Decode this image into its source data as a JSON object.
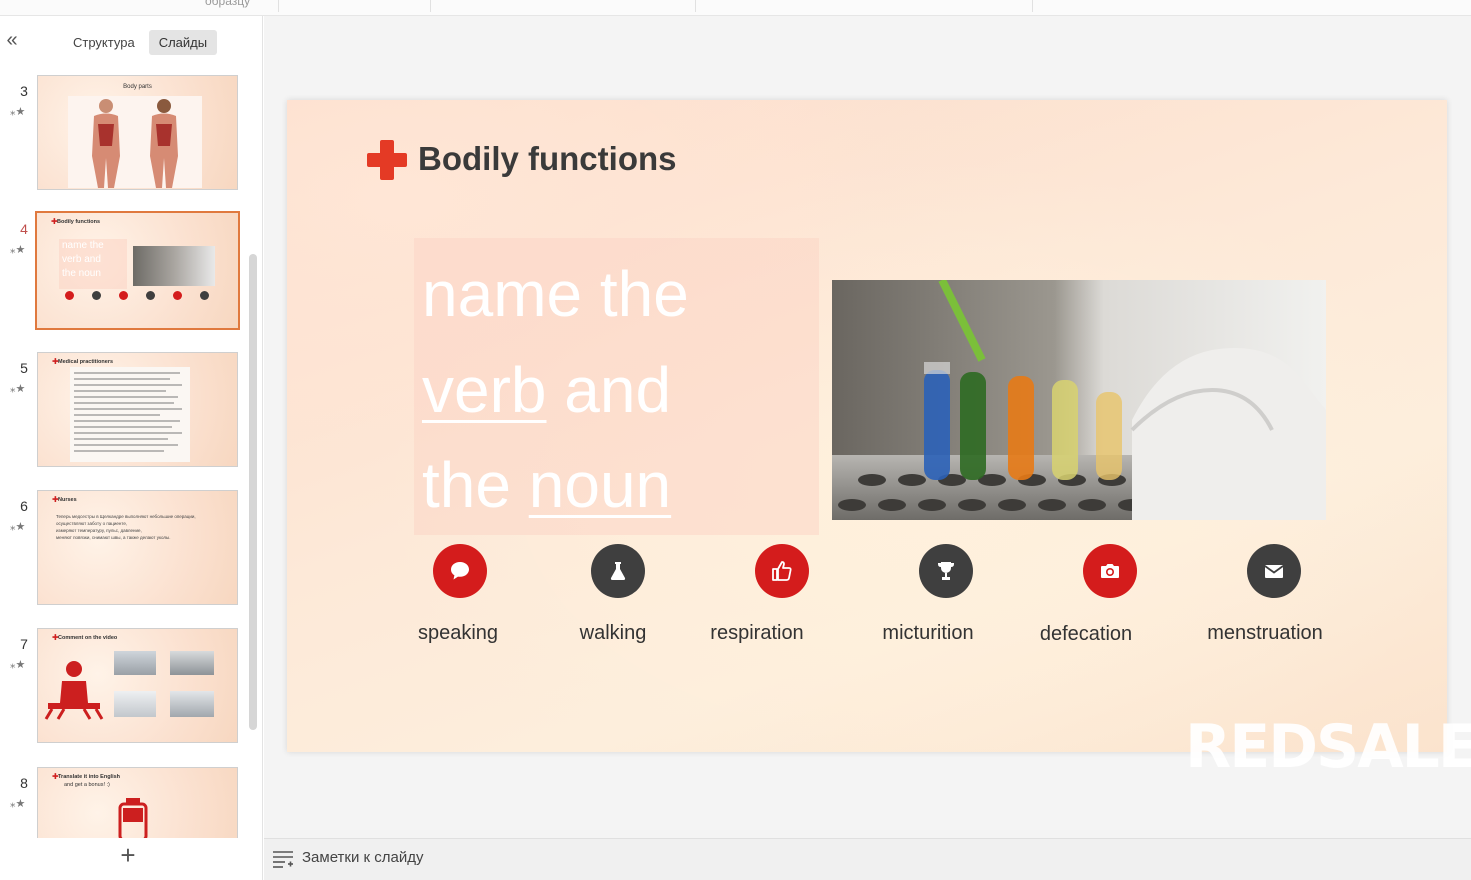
{
  "top": {
    "cut_text": "образцу"
  },
  "left_panel": {
    "tabs": [
      {
        "label": "Структура"
      },
      {
        "label": "Слайды"
      }
    ],
    "active_tab": "Слайды",
    "selected_slide": "4",
    "thumbnails": [
      {
        "number": "3",
        "title": "Body parts"
      },
      {
        "number": "4",
        "title": "Bodily functions",
        "lines": [
          "name the",
          "verb and",
          "the noun"
        ]
      },
      {
        "number": "5",
        "title": "Medical practitioners"
      },
      {
        "number": "6",
        "title": "Nurses",
        "lines": [
          "Теперь медсестры в Щелкандре выполняют небольшие операции,",
          "осуществляют заботу о пациенте,",
          "измеряют температуру, пульс, давление,",
          "меняют повязки, снимают швы, а также делают уколы."
        ]
      },
      {
        "number": "7",
        "title": "Comment on the video"
      },
      {
        "number": "8",
        "title": "Translate it into English",
        "subtitle": "and get a bonus! :)"
      }
    ]
  },
  "slide": {
    "title": "Bodily functions",
    "text_lines": [
      "name the",
      "verb",
      "and",
      "the",
      "noun"
    ],
    "items": [
      {
        "label": "speaking",
        "icon": "speech-bubble-icon",
        "color": "#d41c1c"
      },
      {
        "label": "walking",
        "icon": "flask-icon",
        "color": "#3f3f3f"
      },
      {
        "label": "respiration",
        "icon": "thumbs-up-icon",
        "color": "#d41c1c"
      },
      {
        "label": "micturition",
        "icon": "trophy-icon",
        "color": "#3f3f3f"
      },
      {
        "label": "defecation",
        "icon": "camera-icon",
        "color": "#d41c1c"
      },
      {
        "label": "menstruation",
        "icon": "envelope-icon",
        "color": "#3f3f3f"
      }
    ],
    "watermark": "REDSALE"
  },
  "notes": {
    "label": "Заметки к слайду"
  },
  "colors": {
    "accent_selection": "#e0793e",
    "red": "#d41c1c",
    "dark": "#3f3f3f"
  }
}
